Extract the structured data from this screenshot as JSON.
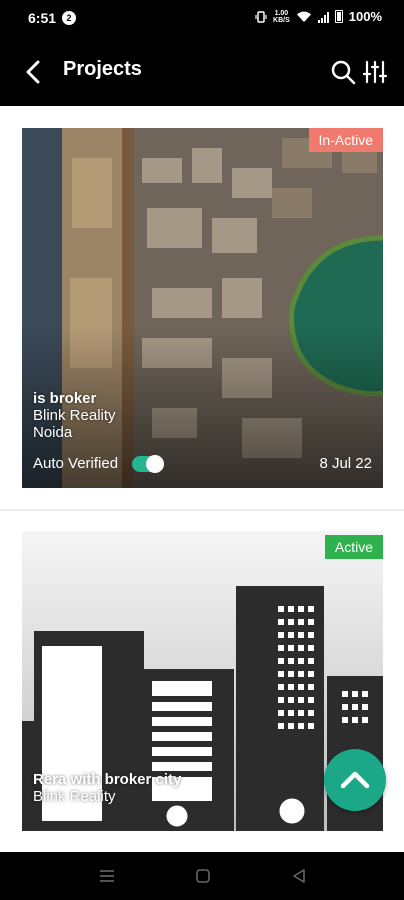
{
  "status_bar": {
    "time": "6:51",
    "notification_badge": "2",
    "net_speed_top": "1.00",
    "net_speed_bottom": "KB/S",
    "battery": "100%"
  },
  "app_bar": {
    "title": "Projects",
    "back_icon": "chevron-left-icon",
    "search_icon": "search-icon",
    "filter_icon": "sliders-icon"
  },
  "projects": [
    {
      "status": "In-Active",
      "status_color": "#f07a6d",
      "name": "is broker",
      "developer": "Blink Reality",
      "location": "Noida",
      "verify_label": "Auto Verified",
      "auto_verified": true,
      "date": "8 Jul 22"
    },
    {
      "status": "Active",
      "status_color": "#2fb14d",
      "name": "Rera with broker city",
      "developer": "Blink Reality"
    }
  ],
  "fab": {
    "icon": "chevron-up-icon",
    "color": "#1ba888"
  },
  "toggle_color": "#25b58f",
  "nav_bar": {
    "icons": [
      "menu-icon",
      "home-square-icon",
      "back-triangle-icon"
    ]
  }
}
